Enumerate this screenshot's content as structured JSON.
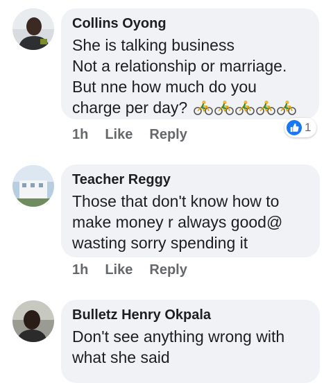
{
  "colors": {
    "bubble": "#f0f2f5",
    "author": "#1c1e21",
    "meta": "#65676b",
    "like_blue": "#1877f2"
  },
  "comments": [
    {
      "author": "Collins Oyong",
      "lines": [
        "She is talking business",
        "Not a relationship or marriage.",
        "But nne how much do you",
        "charge per day?"
      ],
      "emoji": "bicyclist-emoji",
      "emoji_count": 5,
      "time": "1h",
      "like_label": "Like",
      "reply_label": "Reply",
      "reaction_count": "1",
      "reaction_icon": "thumbs-up-icon"
    },
    {
      "author": "Teacher Reggy",
      "lines": [
        "Those that don't know how to",
        "make money r always good@",
        "wasting sorry spending it"
      ],
      "time": "1h",
      "like_label": "Like",
      "reply_label": "Reply"
    },
    {
      "author": "Bulletz Henry Okpala",
      "lines": [
        "Don't see anything wrong with",
        "what she said"
      ]
    }
  ]
}
